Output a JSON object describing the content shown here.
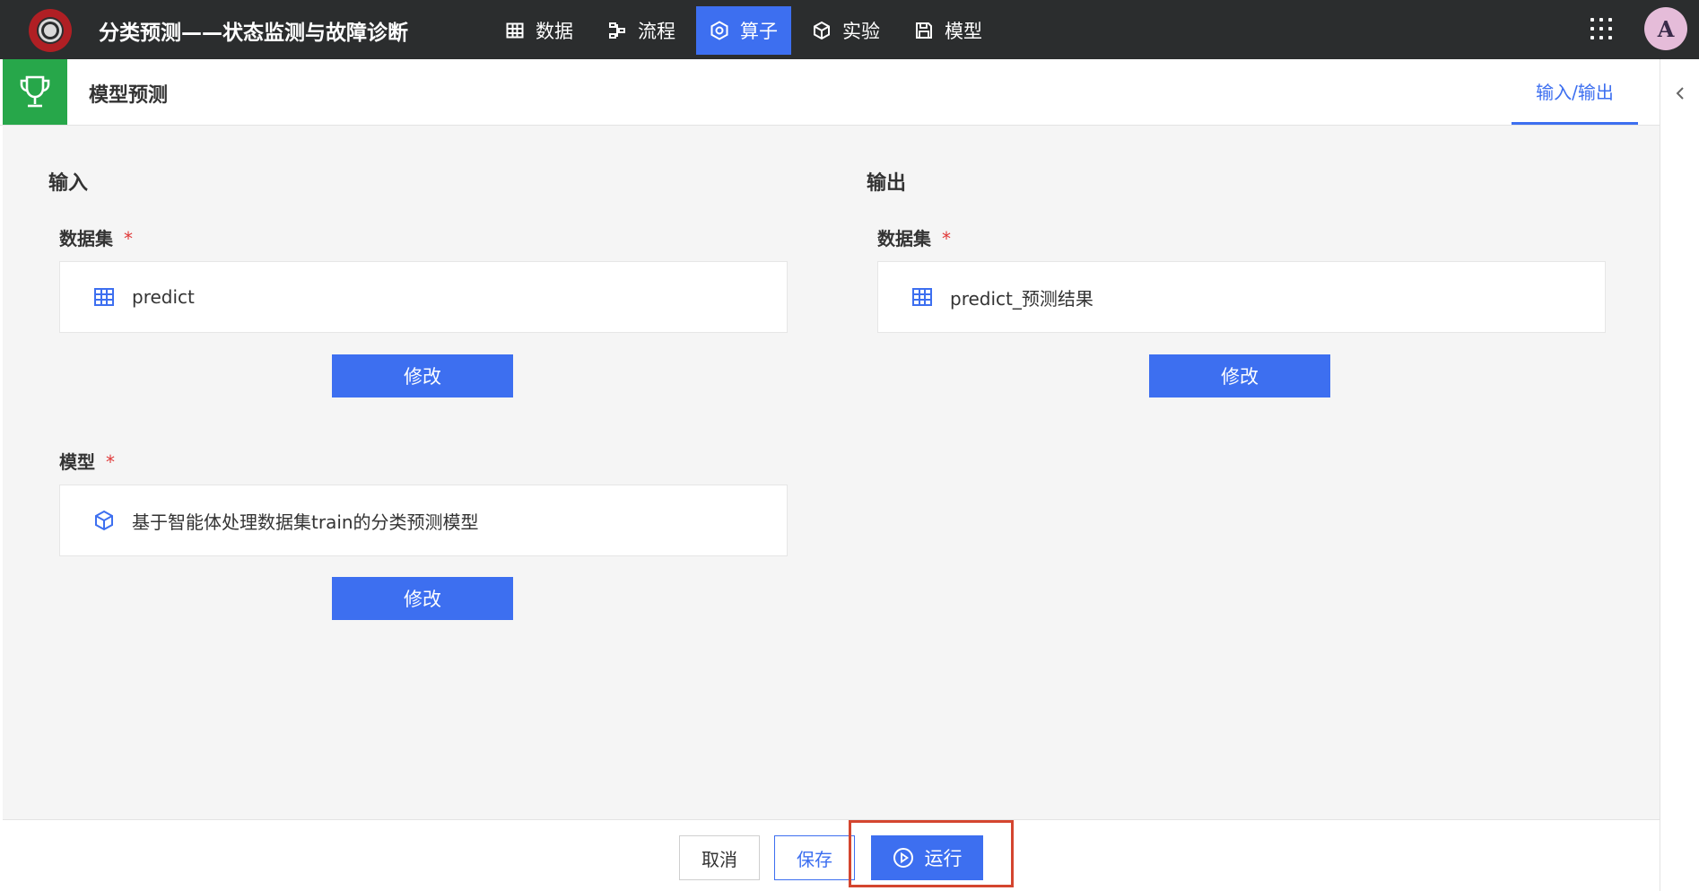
{
  "header": {
    "app_title": "分类预测——状态监测与故障诊断",
    "nav": [
      {
        "label": "数据",
        "icon": "table-icon"
      },
      {
        "label": "流程",
        "icon": "flow-icon"
      },
      {
        "label": "算子",
        "icon": "operator-icon",
        "active": true
      },
      {
        "label": "实验",
        "icon": "cube-icon"
      },
      {
        "label": "模型",
        "icon": "save-icon"
      }
    ],
    "avatar_letter": "A"
  },
  "subheader": {
    "page_title": "模型预测",
    "tab_label": "输入/输出"
  },
  "input": {
    "section_title": "输入",
    "dataset_label": "数据集",
    "dataset_value": "predict",
    "dataset_modify": "修改",
    "model_label": "模型",
    "model_value": "基于智能体处理数据集train的分类预测模型",
    "model_modify": "修改",
    "required_mark": "*"
  },
  "output": {
    "section_title": "输出",
    "dataset_label": "数据集",
    "dataset_value": "predict_预测结果",
    "dataset_modify": "修改",
    "required_mark": "*"
  },
  "footer": {
    "cancel_label": "取消",
    "save_label": "保存",
    "run_label": "运行"
  },
  "colors": {
    "accent": "#3d6ff0",
    "topbar": "#2b2d2e",
    "trophy_bg": "#27a74a",
    "required": "#e03a3a",
    "highlight": "#d4452f"
  }
}
